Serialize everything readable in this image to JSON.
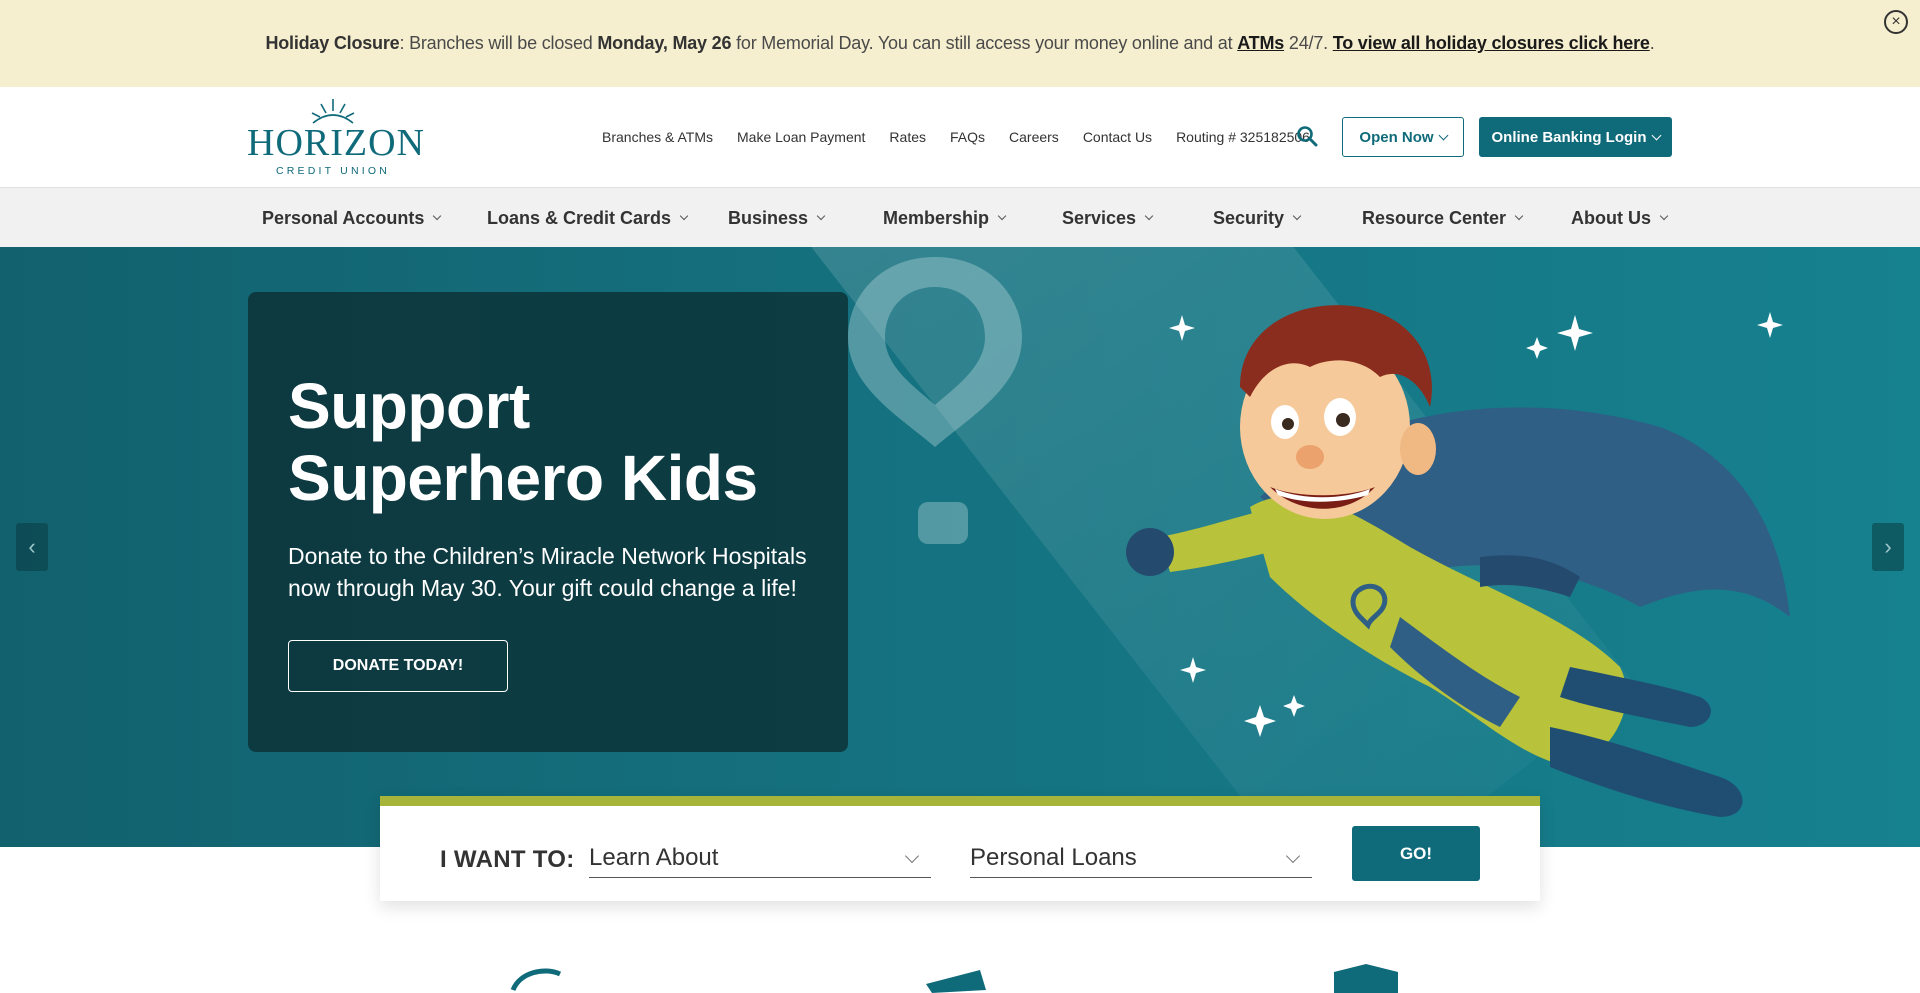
{
  "alert": {
    "label": "Holiday Closure",
    "text_1": ": Branches will be closed ",
    "date": "Monday, May 26",
    "text_2": " for Memorial Day. You can still access your money online and at ",
    "atms": "ATMs",
    "text_3": " 24/7. ",
    "link": "To view all holiday closures click here",
    "text_4": ".",
    "close_icon": "close-icon"
  },
  "logo": {
    "word": "HORIZON",
    "sub": "CREDIT UNION"
  },
  "utility": {
    "branches": "Branches & ATMs",
    "loan_payment": "Make Loan Payment",
    "rates": "Rates",
    "faqs": "FAQs",
    "careers": "Careers",
    "contact": "Contact Us",
    "routing": "Routing # 325182506",
    "search_icon": "search-icon",
    "open_now": "Open Now",
    "login": "Online Banking Login"
  },
  "nav": {
    "items": [
      {
        "label": "Personal Accounts"
      },
      {
        "label": "Loans & Credit Cards"
      },
      {
        "label": "Business"
      },
      {
        "label": "Membership"
      },
      {
        "label": "Services"
      },
      {
        "label": "Security"
      },
      {
        "label": "Resource Center"
      },
      {
        "label": "About Us"
      }
    ]
  },
  "hero": {
    "title": "Support Superhero Kids",
    "text": "Donate to the Children’s Miracle Network Hospitals now through May 30. Your gift could change a life!",
    "button": "DONATE TODAY!",
    "prev": "‹",
    "next": "›"
  },
  "iwant": {
    "label": "I WANT TO:",
    "select_1": "Learn About",
    "select_2": "Personal Loans",
    "go": "GO!"
  },
  "colors": {
    "brand": "#0f6a7a",
    "accent": "#a7b43a",
    "alert_bg": "#f6efcf"
  }
}
